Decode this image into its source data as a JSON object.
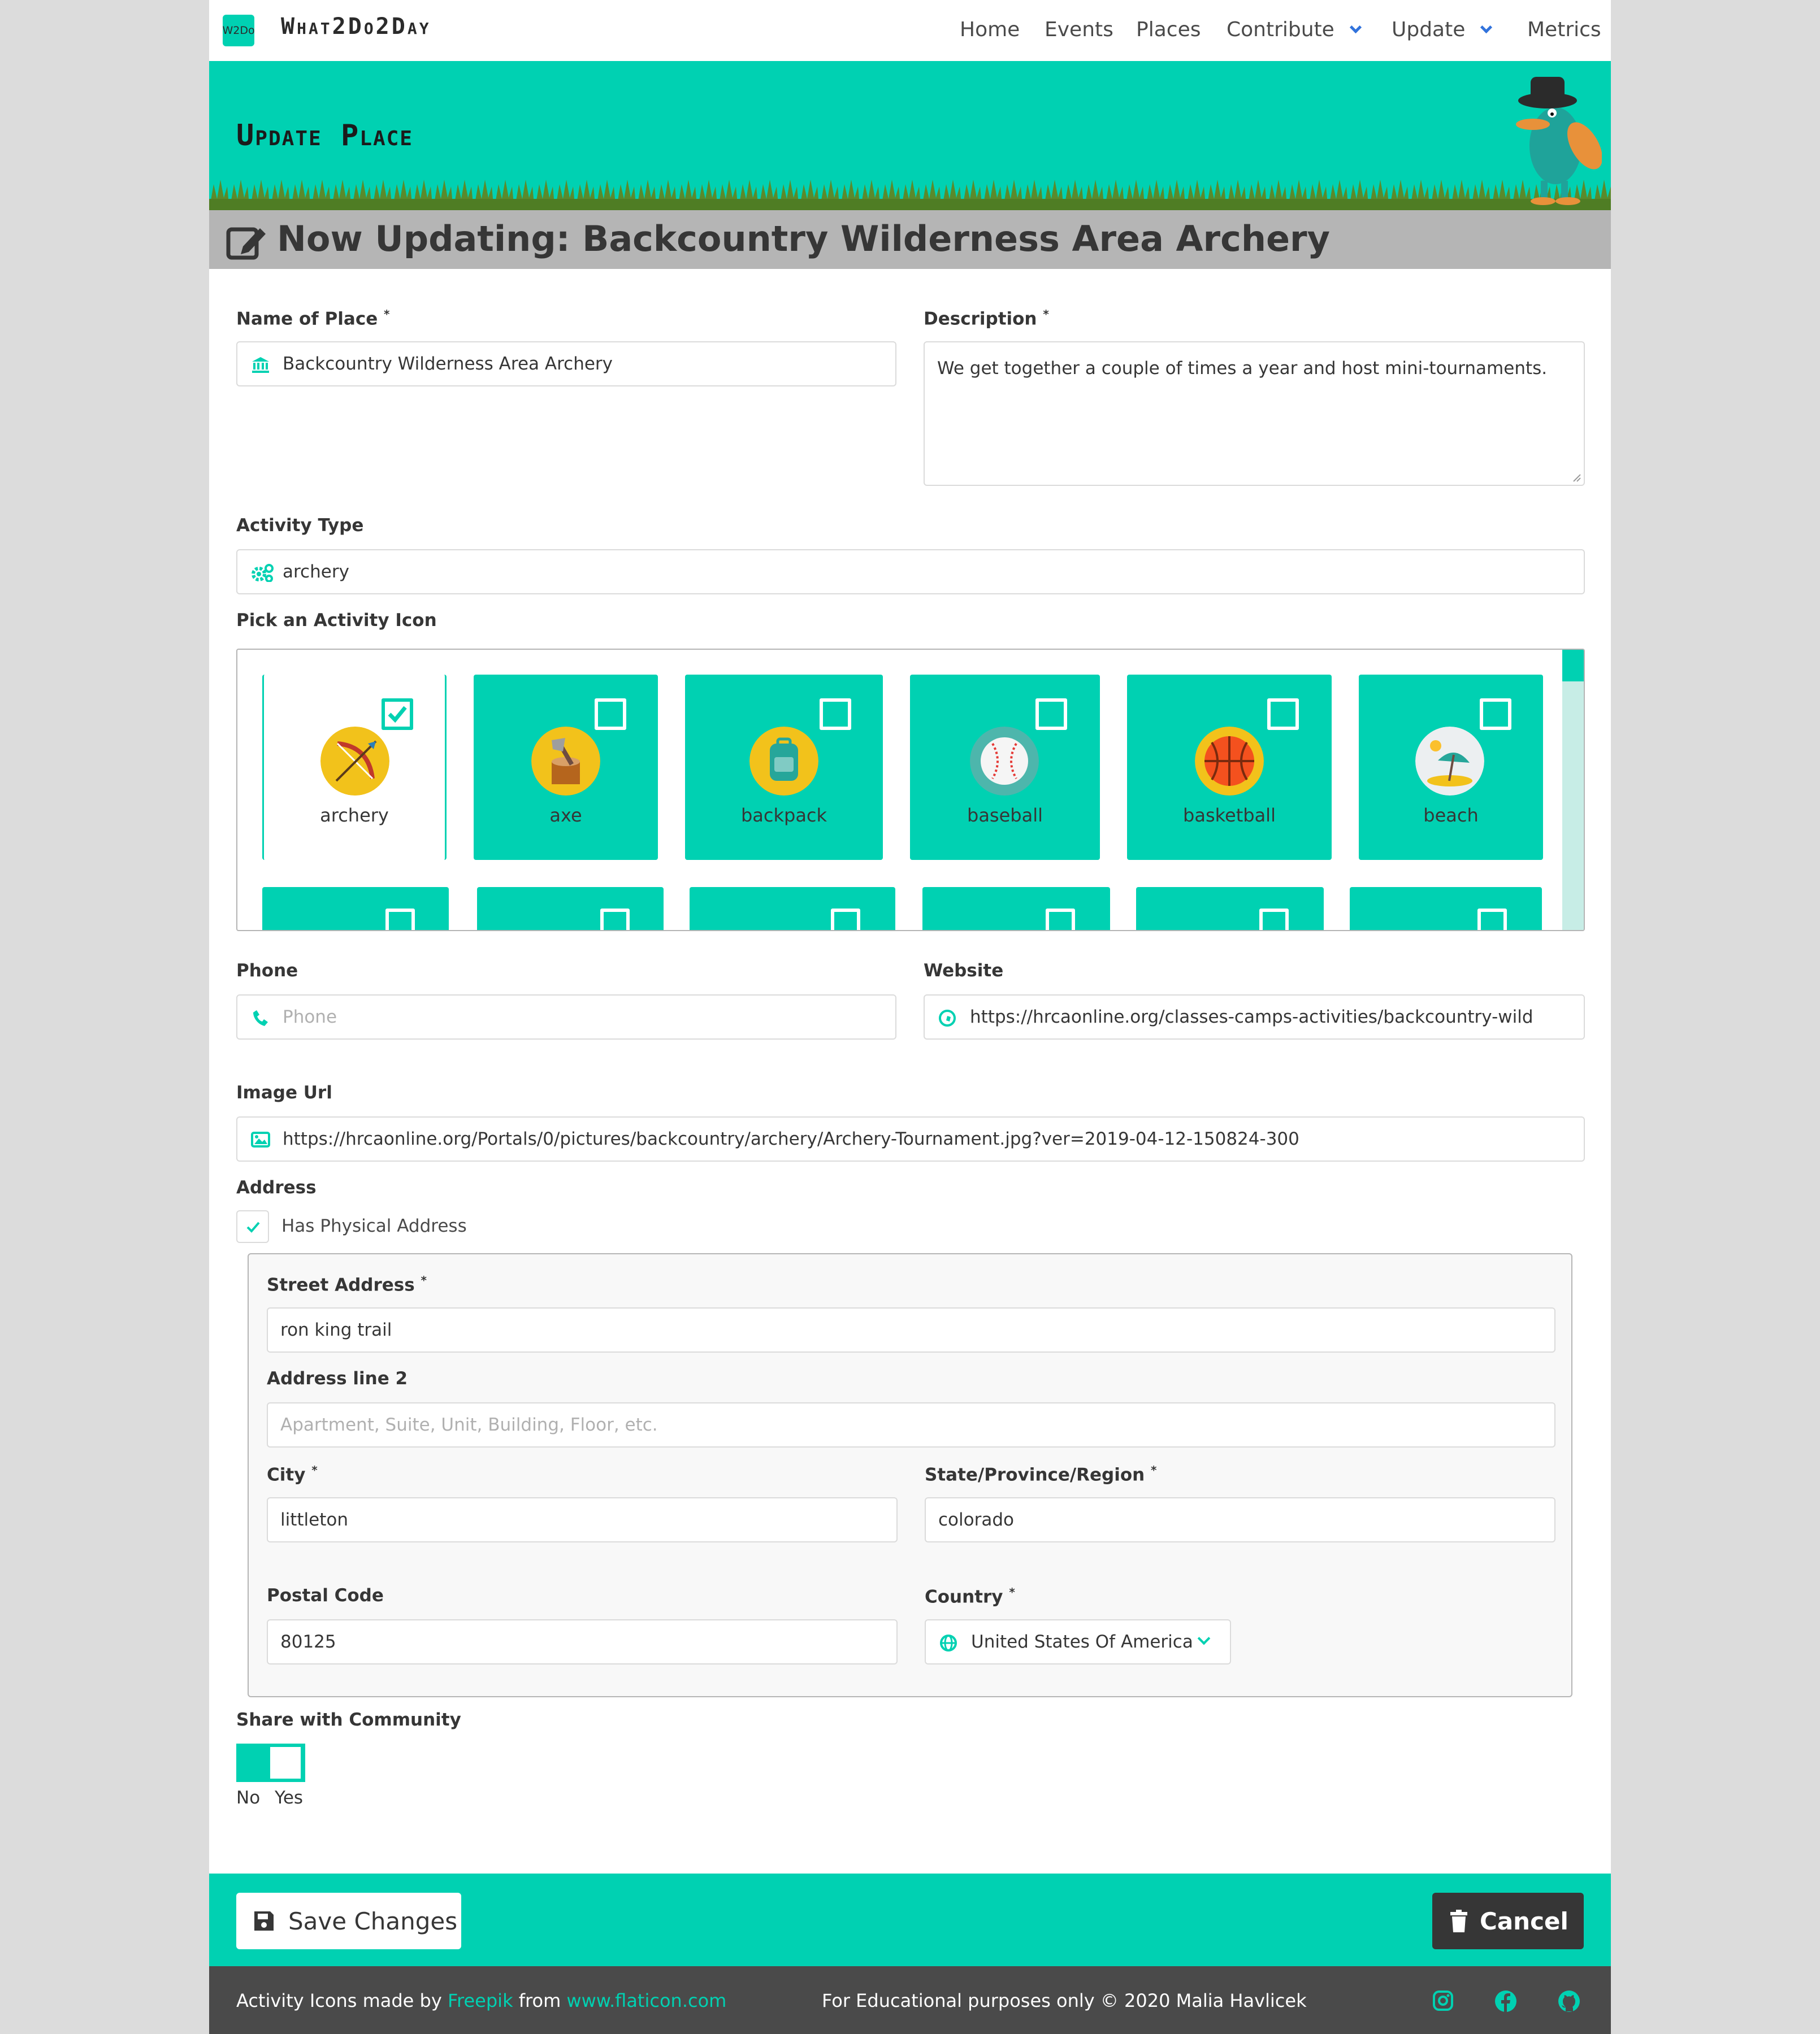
{
  "nav": {
    "logo_text": "W2Do",
    "brand": "What2Do2Day",
    "items": [
      "Home",
      "Events",
      "Places",
      "Contribute",
      "Update",
      "Metrics"
    ]
  },
  "hero": {
    "title": "Update Place"
  },
  "subtitle": "Now Updating: Backcountry Wilderness Area Archery",
  "form": {
    "name_label": "Name of Place",
    "name_value": "Backcountry Wilderness Area Archery",
    "description_label": "Description",
    "description_value": "We get together a couple of times a year and host mini-tournaments.",
    "activity_label": "Activity Type",
    "activity_value": "archery",
    "icon_label": "Pick an Activity Icon",
    "icons": [
      {
        "name": "archery",
        "selected": true
      },
      {
        "name": "axe",
        "selected": false
      },
      {
        "name": "backpack",
        "selected": false
      },
      {
        "name": "baseball",
        "selected": false
      },
      {
        "name": "basketball",
        "selected": false
      },
      {
        "name": "beach",
        "selected": false
      }
    ],
    "phone_label": "Phone",
    "phone_placeholder": "Phone",
    "website_label": "Website",
    "website_value": "https://hrcaonline.org/classes-camps-activities/backcountry-wild",
    "image_label": "Image Url",
    "image_value": "https://hrcaonline.org/Portals/0/pictures/backcountry/archery/Archery-Tournament.jpg?ver=2019-04-12-150824-300",
    "address_label": "Address",
    "has_address_label": "Has Physical Address",
    "has_address_checked": true,
    "street_label": "Street Address",
    "street_value": "ron king trail",
    "line2_label": "Address line 2",
    "line2_placeholder": "Apartment, Suite, Unit, Building, Floor, etc.",
    "city_label": "City",
    "city_value": "littleton",
    "state_label": "State/Province/Region",
    "state_value": "colorado",
    "postal_label": "Postal Code",
    "postal_value": "80125",
    "country_label": "Country",
    "country_value": "United States Of America",
    "share_label": "Share with Community",
    "share_no": "No",
    "share_yes": "Yes",
    "share_on": true
  },
  "actions": {
    "save": "Save Changes",
    "cancel": "Cancel"
  },
  "footer": {
    "credit_prefix": "Activity Icons made by",
    "credit_author": "Freepik",
    "credit_from": "from",
    "credit_site": "www.flaticon.com",
    "center": "For Educational purposes only © 2020 Malia Havlicek"
  },
  "colors": {
    "accent": "#00d1b2",
    "dark": "#363636",
    "link": "#3273dc"
  }
}
